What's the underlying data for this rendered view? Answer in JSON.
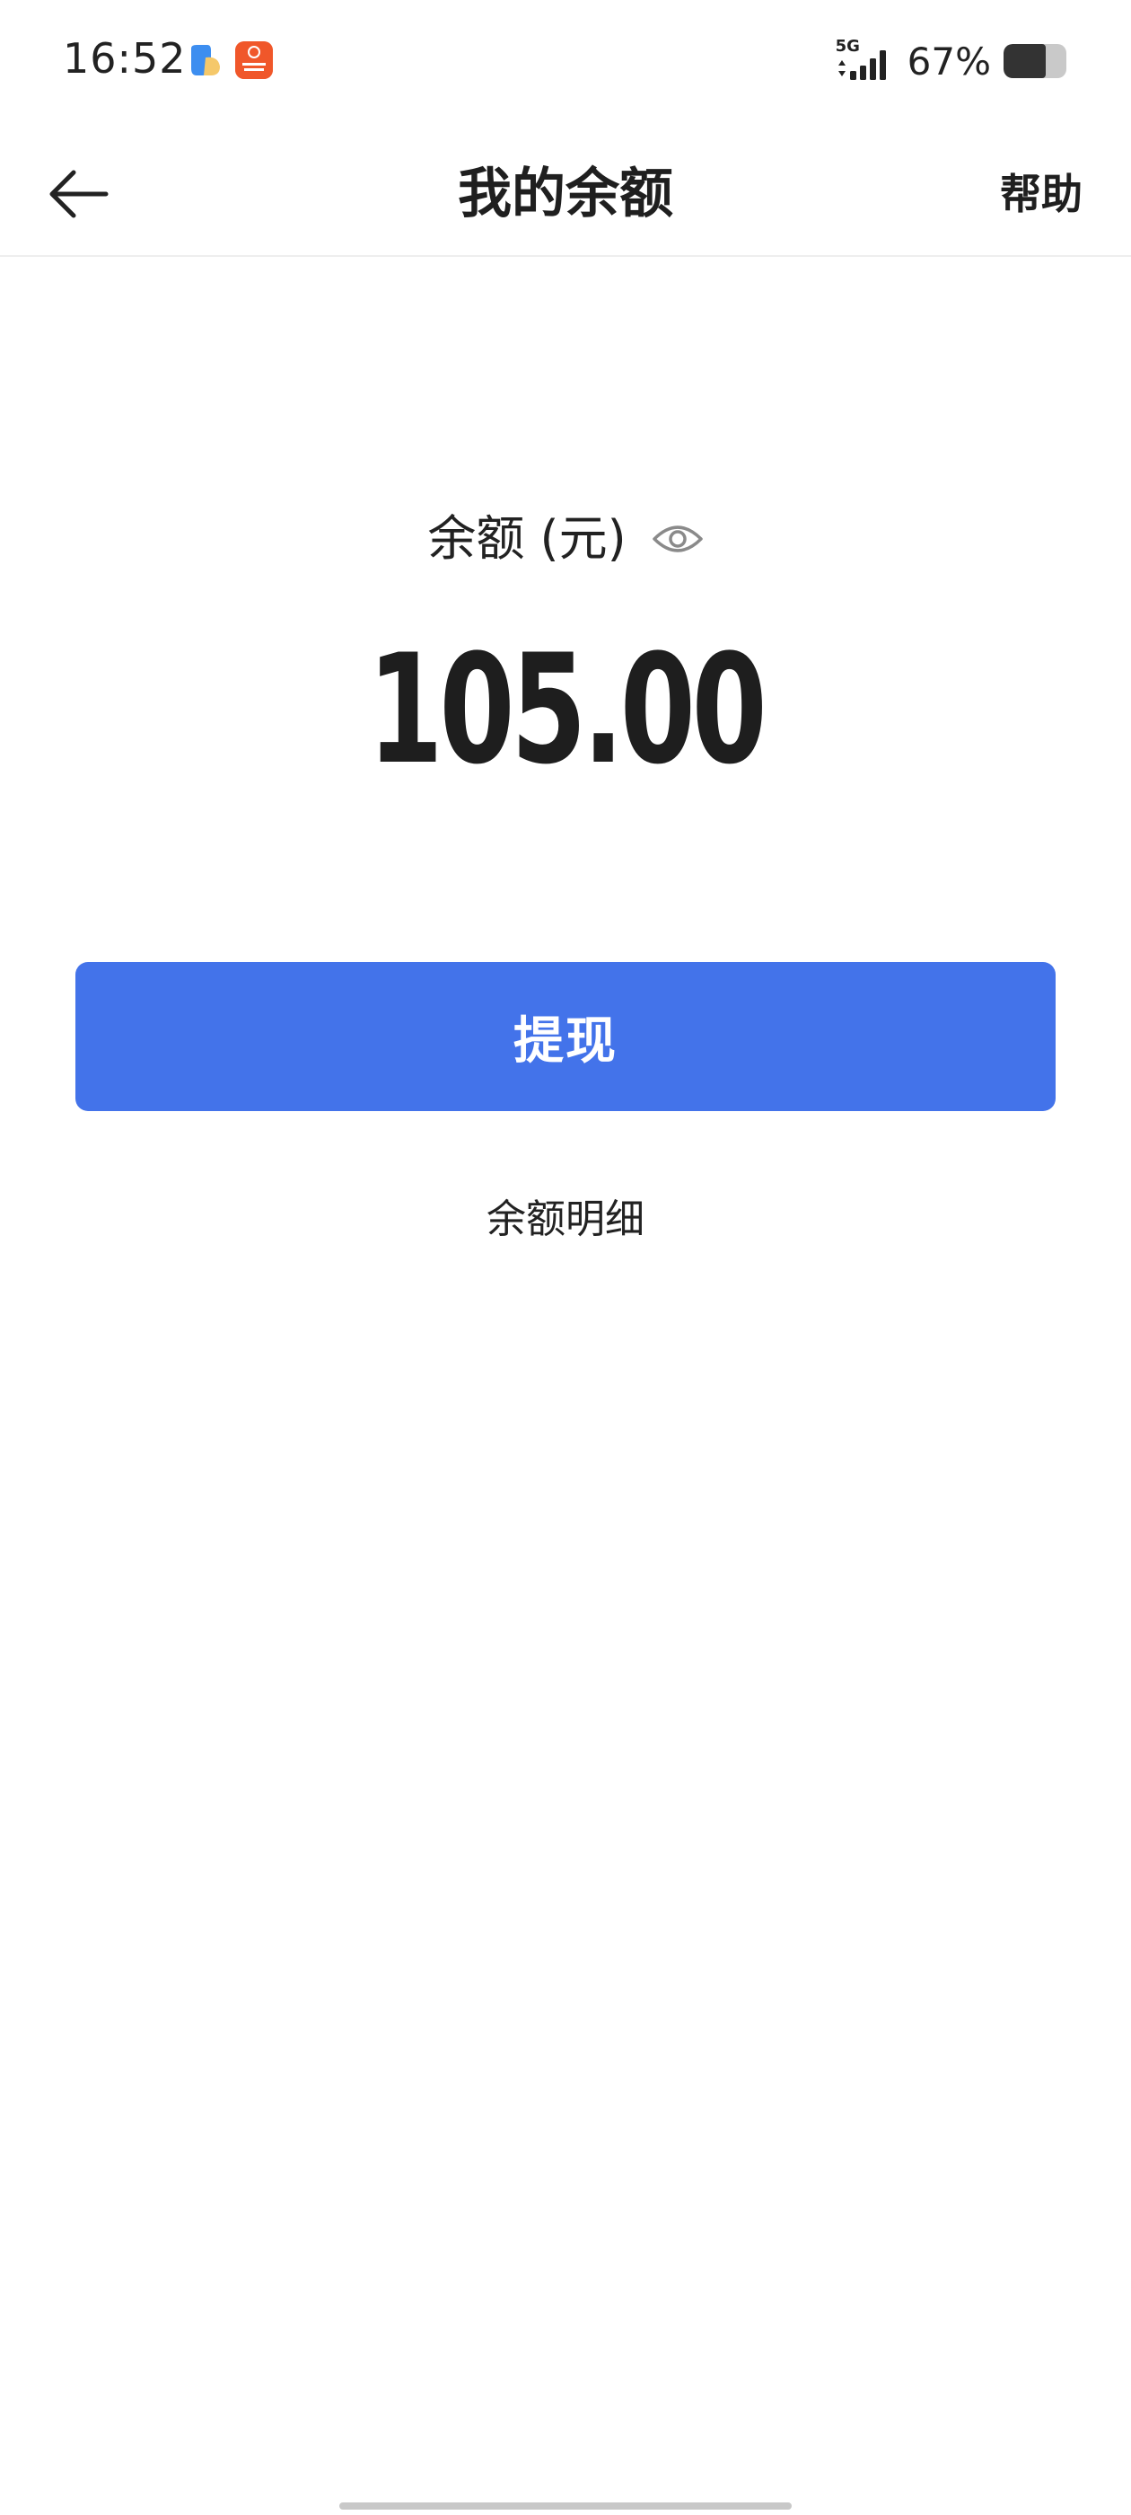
{
  "status_bar": {
    "time": "16:52",
    "network_type": "5G",
    "battery_percent_text": "67%",
    "battery_level": 0.67,
    "notification_icons": [
      "blue-app-icon",
      "orange-fund-app-icon"
    ]
  },
  "nav": {
    "title": "我的余额",
    "help_label": "帮助",
    "back_icon": "arrow-left-icon"
  },
  "balance": {
    "label": "余额 (元)",
    "amount": "105.00",
    "visibility_icon": "eye-icon"
  },
  "actions": {
    "withdraw_label": "提现",
    "details_label": "余额明细"
  },
  "colors": {
    "primary": "#4373ea",
    "text": "#1f1f1f",
    "background": "#ffffff"
  }
}
